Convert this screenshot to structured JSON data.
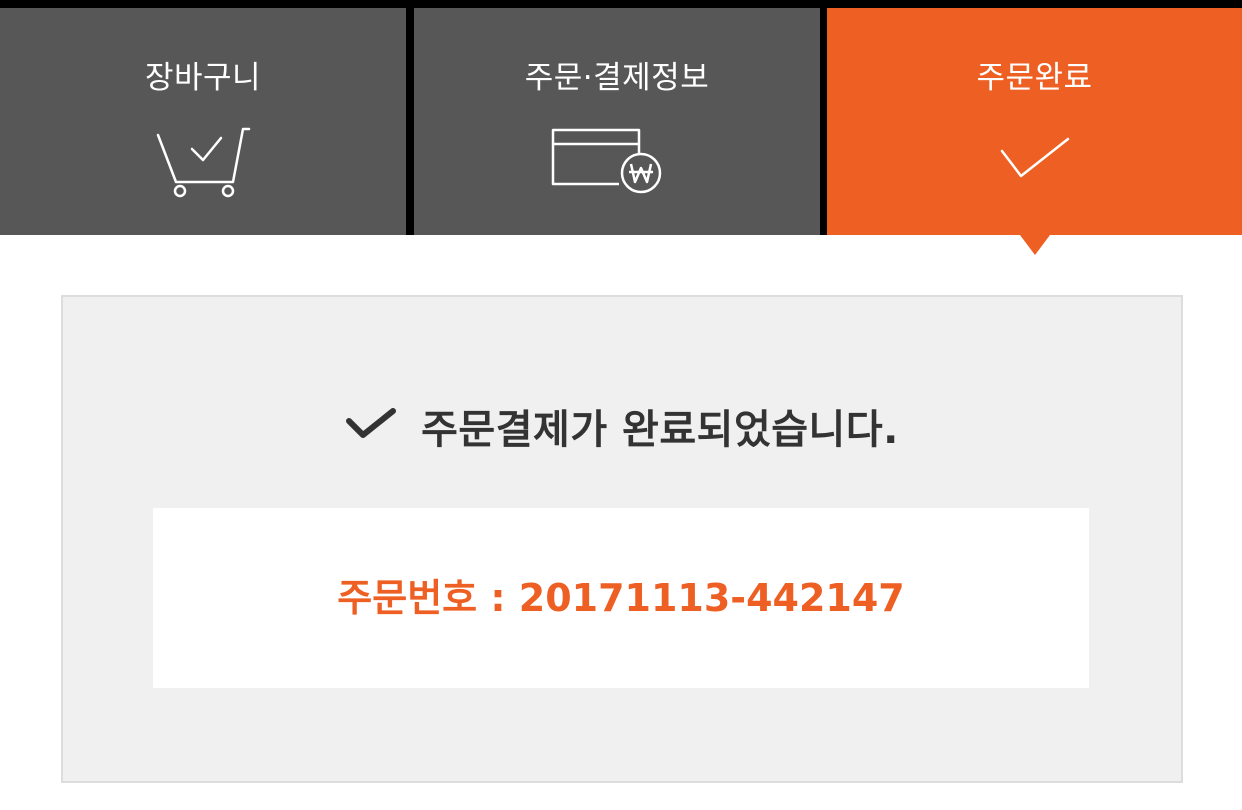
{
  "steps": [
    {
      "label": "장바구니",
      "icon": "cart-check-icon",
      "active": false
    },
    {
      "label": "주문·결제정보",
      "icon": "card-won-icon",
      "active": false
    },
    {
      "label": "주문완료",
      "icon": "check-icon",
      "active": true
    }
  ],
  "result": {
    "message": "주문결제가 완료되었습니다.",
    "message_icon": "check-icon",
    "order_number": "주문번호 : 20171113-442147"
  },
  "colors": {
    "accent": "#ee5f23",
    "step_inactive": "#575757",
    "panel_background": "#f0f0f0",
    "text_dark": "#333333"
  }
}
